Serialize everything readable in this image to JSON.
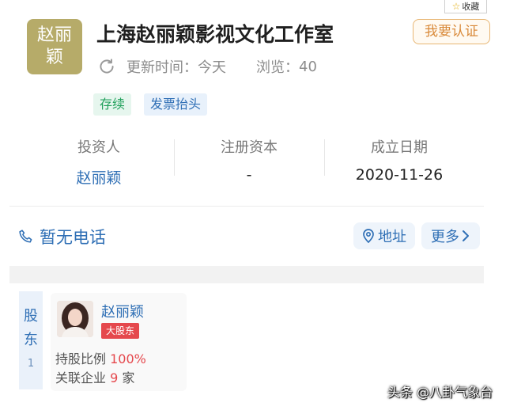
{
  "favorite": {
    "icon": "star-icon",
    "label": "收藏"
  },
  "company": {
    "logo_line1": "赵丽",
    "logo_line2": "颖",
    "logo_color": "#b6ab69",
    "name": "上海赵丽颖影视文化工作室",
    "verify_label": "我要认证"
  },
  "meta": {
    "update_label": "更新时间：",
    "update_value": "今天",
    "views_label": "浏览：",
    "views_value": "40"
  },
  "tags": [
    {
      "label": "存续",
      "color": "#23a15d"
    },
    {
      "label": "发票抬头",
      "color": "#2f6fb5"
    }
  ],
  "info": [
    {
      "label": "投资人",
      "value": "赵丽颖"
    },
    {
      "label": "注册资本",
      "value": "-"
    },
    {
      "label": "成立日期",
      "value": "2020-11-26"
    }
  ],
  "contact": {
    "phone_label": "暂无电话",
    "address_label": "地址",
    "more_label": "更多"
  },
  "shareholders": {
    "section_label_line1": "股",
    "section_label_line2": "东",
    "count": "1",
    "items": [
      {
        "name": "赵丽颖",
        "badge": "大股东",
        "pct_label": "持股比例",
        "pct_value": "100%",
        "related_label": "关联企业",
        "related_value": "9",
        "related_unit": "家"
      }
    ]
  },
  "watermark": "头条 @八卦气象台",
  "accent_color": "#2f6fb5"
}
